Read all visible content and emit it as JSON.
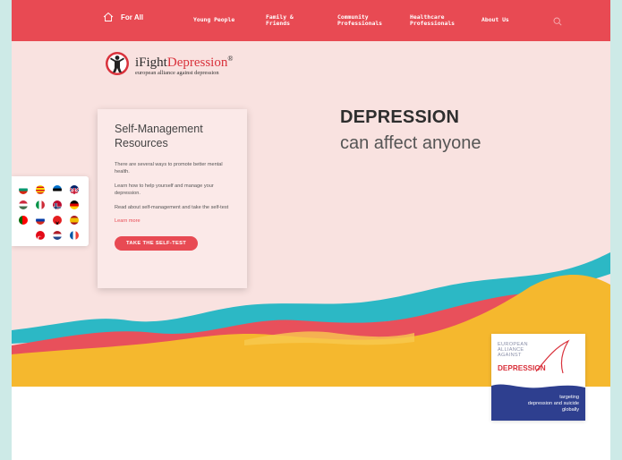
{
  "nav": {
    "home_label": "For All",
    "items": [
      {
        "label_line1": "Young People",
        "label_line2": ""
      },
      {
        "label_line1": "Family &",
        "label_line2": "Friends"
      },
      {
        "label_line1": "Community",
        "label_line2": "Professionals"
      },
      {
        "label_line1": "Healthcare",
        "label_line2": "Professionals"
      },
      {
        "label_line1": "About Us",
        "label_line2": ""
      }
    ]
  },
  "logo": {
    "brand_prefix": "i",
    "brand_fight": "Fight",
    "brand_depression": "Depression",
    "registered": "®",
    "tagline": "european alliance against depression"
  },
  "headline": {
    "line1": "DEPRESSION",
    "line2": "can affect anyone"
  },
  "card": {
    "title": "Self-Management Resources",
    "p1": "There are several ways to promote better mental health.",
    "p2": "Learn how to help yourself and manage your depression.",
    "p3": "Read about self-management and take the self-test",
    "learn_more": "Learn more",
    "cta": "TAKE THE SELF-TEST"
  },
  "badge": {
    "line1": "EUROPEAN",
    "line2": "ALLIANCE",
    "line3": "AGAINST",
    "word": "DEPRESSION",
    "tag1": "targeting",
    "tag2": "depression and suicide",
    "tag3": "globally"
  },
  "colors": {
    "brand_red": "#e84a53",
    "hero_bg": "#f9e2e0",
    "wave_teal": "#2cb8c5",
    "wave_yellow": "#f5b82e",
    "wave_red": "#e8505b",
    "badge_blue": "#2e3f8f"
  },
  "icons": {
    "home": "home-icon",
    "search": "search-icon",
    "logo": "ifightdepression-logo-icon"
  }
}
